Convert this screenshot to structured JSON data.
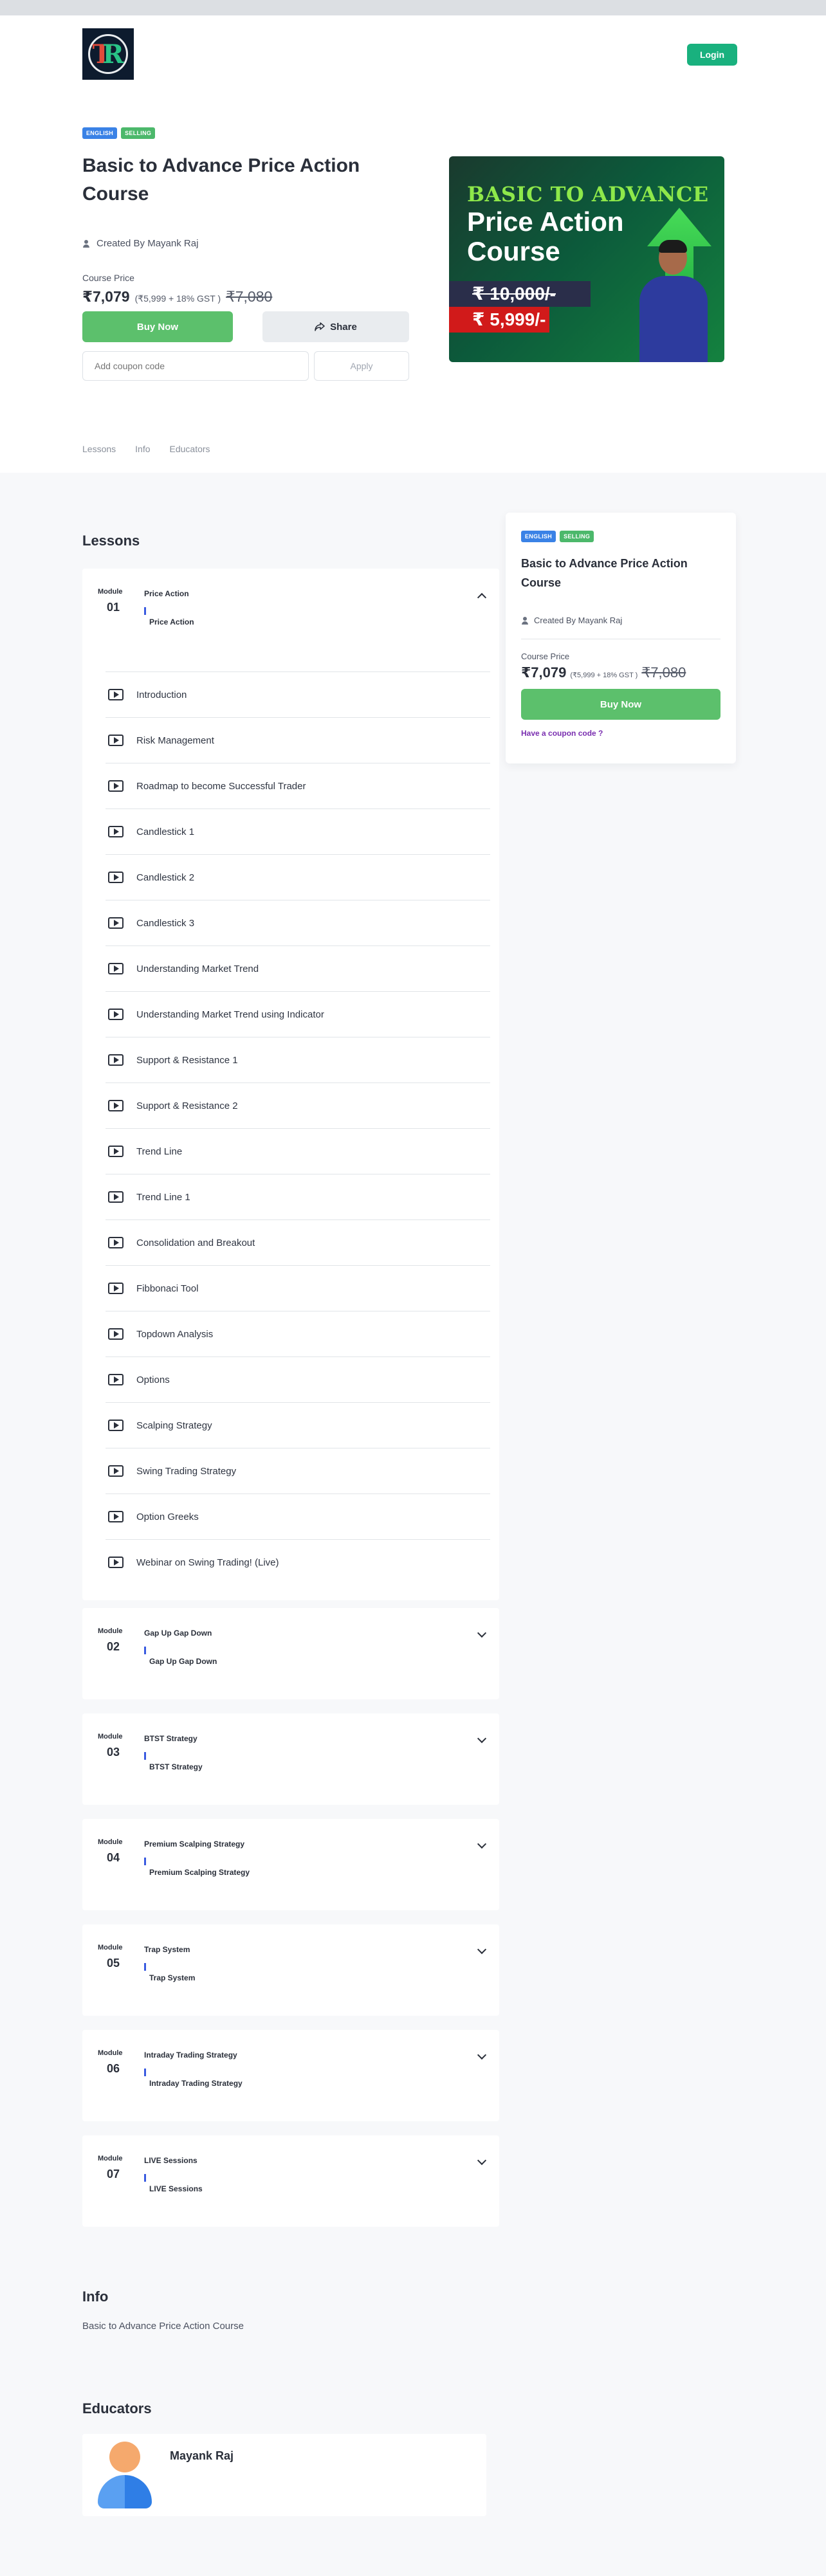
{
  "header": {
    "login_label": "Login"
  },
  "course": {
    "badges": [
      "ENGLISH",
      "SELLING"
    ],
    "title": "Basic to Advance Price Action Course",
    "creator": "Created By Mayank Raj",
    "price_label": "Course Price",
    "price": "₹7,079",
    "price_breakdown": "(₹5,999 + 18% GST )",
    "price_old": "₹7,080",
    "buy_label": "Buy Now",
    "share_label": "Share",
    "coupon_placeholder": "Add coupon code",
    "apply_label": "Apply"
  },
  "banner": {
    "line1": "BASIC TO ADVANCE",
    "line2": "Price Action",
    "line3": "Course",
    "old_price": "₹ 10,000/-",
    "new_price": "₹ 5,999/-"
  },
  "tabs": [
    "Lessons",
    "Info",
    "Educators"
  ],
  "lessons_title": "Lessons",
  "module_label": "Module",
  "modules": [
    {
      "num": "01",
      "name": "Price Action",
      "sub": "Price Action",
      "lessons": [
        "Introduction",
        "Risk Management",
        "Roadmap to become Successful Trader",
        "Candlestick 1",
        "Candlestick 2",
        "Candlestick 3",
        "Understanding Market Trend",
        "Understanding Market Trend using Indicator",
        "Support & Resistance 1",
        "Support & Resistance 2",
        "Trend Line",
        "Trend Line 1",
        "Consolidation and Breakout",
        "Fibbonaci Tool",
        "Topdown Analysis",
        "Options",
        "Scalping Strategy",
        "Swing Trading Strategy",
        "Option Greeks",
        "Webinar on Swing Trading! (Live)"
      ]
    },
    {
      "num": "02",
      "name": "Gap Up Gap Down",
      "sub": "Gap Up Gap Down"
    },
    {
      "num": "03",
      "name": "BTST Strategy",
      "sub": "BTST Strategy"
    },
    {
      "num": "04",
      "name": "Premium Scalping Strategy",
      "sub": "Premium Scalping Strategy"
    },
    {
      "num": "05",
      "name": "Trap System",
      "sub": "Trap System"
    },
    {
      "num": "06",
      "name": "Intraday Trading Strategy",
      "sub": "Intraday Trading Strategy"
    },
    {
      "num": "07",
      "name": "LIVE Sessions",
      "sub": "LIVE Sessions"
    }
  ],
  "side_card": {
    "badges": [
      "ENGLISH",
      "SELLING"
    ],
    "title": "Basic to Advance Price Action Course",
    "creator": "Created By Mayank Raj",
    "price_label": "Course Price",
    "price": "₹7,079",
    "price_breakdown": "(₹5,999 + 18% GST )",
    "price_old": "₹7,080",
    "buy_label": "Buy Now",
    "coupon_link": "Have a coupon code ?"
  },
  "info": {
    "title": "Info",
    "text": "Basic to Advance Price Action Course"
  },
  "educators": {
    "title": "Educators",
    "name": "Mayank Raj"
  }
}
